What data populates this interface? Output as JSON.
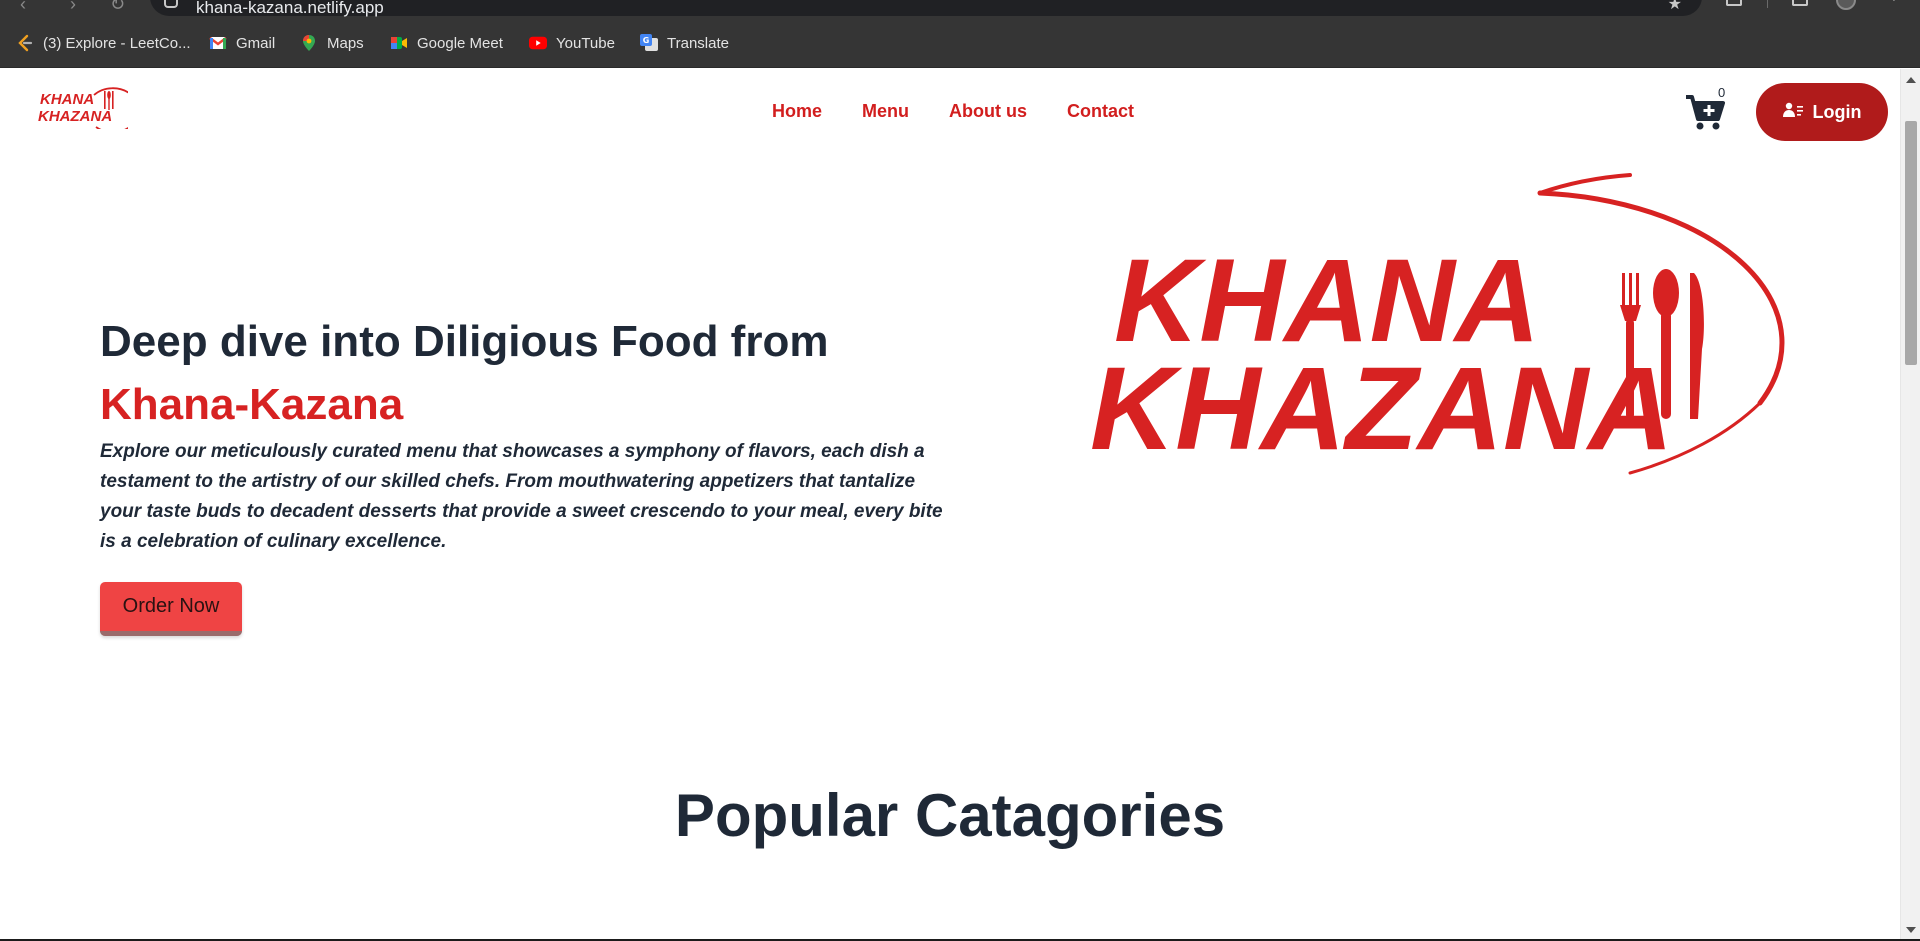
{
  "browser": {
    "url": "khana-kazana.netlify.app",
    "bookmarks": [
      {
        "label": "(3) Explore - LeetCo...",
        "icon": "leetcode-icon"
      },
      {
        "label": "Gmail",
        "icon": "gmail-icon"
      },
      {
        "label": "Maps",
        "icon": "maps-icon"
      },
      {
        "label": "Google Meet",
        "icon": "google-meet-icon"
      },
      {
        "label": "YouTube",
        "icon": "youtube-icon"
      },
      {
        "label": "Translate",
        "icon": "translate-icon"
      }
    ]
  },
  "site": {
    "logo_line1": "KHANA",
    "logo_line2": "KHAZANA",
    "nav": [
      "Home",
      "Menu",
      "About us",
      "Contact"
    ],
    "cart_count": "0",
    "login_label": "Login"
  },
  "hero": {
    "heading": "Deep dive into Diligious Food from",
    "brand": "Khana-Kazana",
    "description": "Explore our meticulously curated menu that showcases a symphony of flavors, each dish a testament to the artistry of our skilled chefs. From mouthwatering appetizers that tantalize your taste buds to decadent desserts that provide a sweet crescendo to your meal, every bite is a celebration of culinary excellence.",
    "cta_label": "Order Now"
  },
  "sections": {
    "popular_title": "Popular Catagories"
  },
  "colors": {
    "brand_red": "#d72222",
    "login_bg": "#b01b1b",
    "cta_bg": "#ef4444",
    "text_dark": "#1f2937",
    "chrome_bg": "#353535"
  }
}
